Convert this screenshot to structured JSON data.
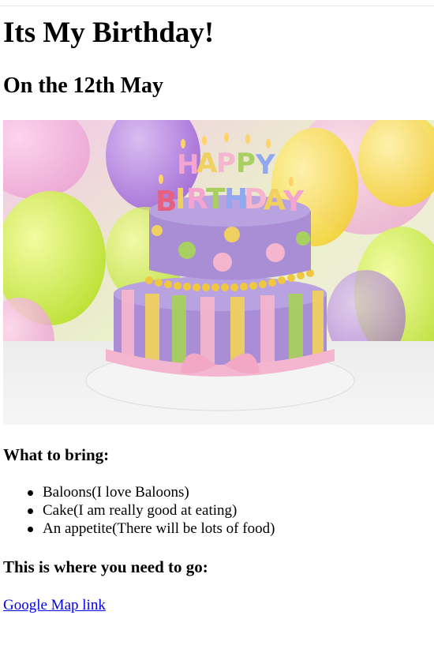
{
  "page": {
    "title": "Its My Birthday!",
    "date_heading": "On the 12th May"
  },
  "hero_image": {
    "icon": "birthday-cake-image",
    "cake_topper_text": "HAPPY BIRTHDAY",
    "colors": {
      "cake_purple": "#a98ed6",
      "accent_yellow": "#f0d060",
      "accent_green": "#a8d060",
      "accent_pink": "#f4b6cf"
    }
  },
  "bring": {
    "heading": "What to bring:",
    "items": [
      "Baloons(I love Baloons)",
      "Cake(I am really good at eating)",
      "An appetite(There will be lots of food)"
    ]
  },
  "location": {
    "heading": "This is where you need to go:",
    "link_text": "Google Map link",
    "link_color": "#0000ee"
  }
}
